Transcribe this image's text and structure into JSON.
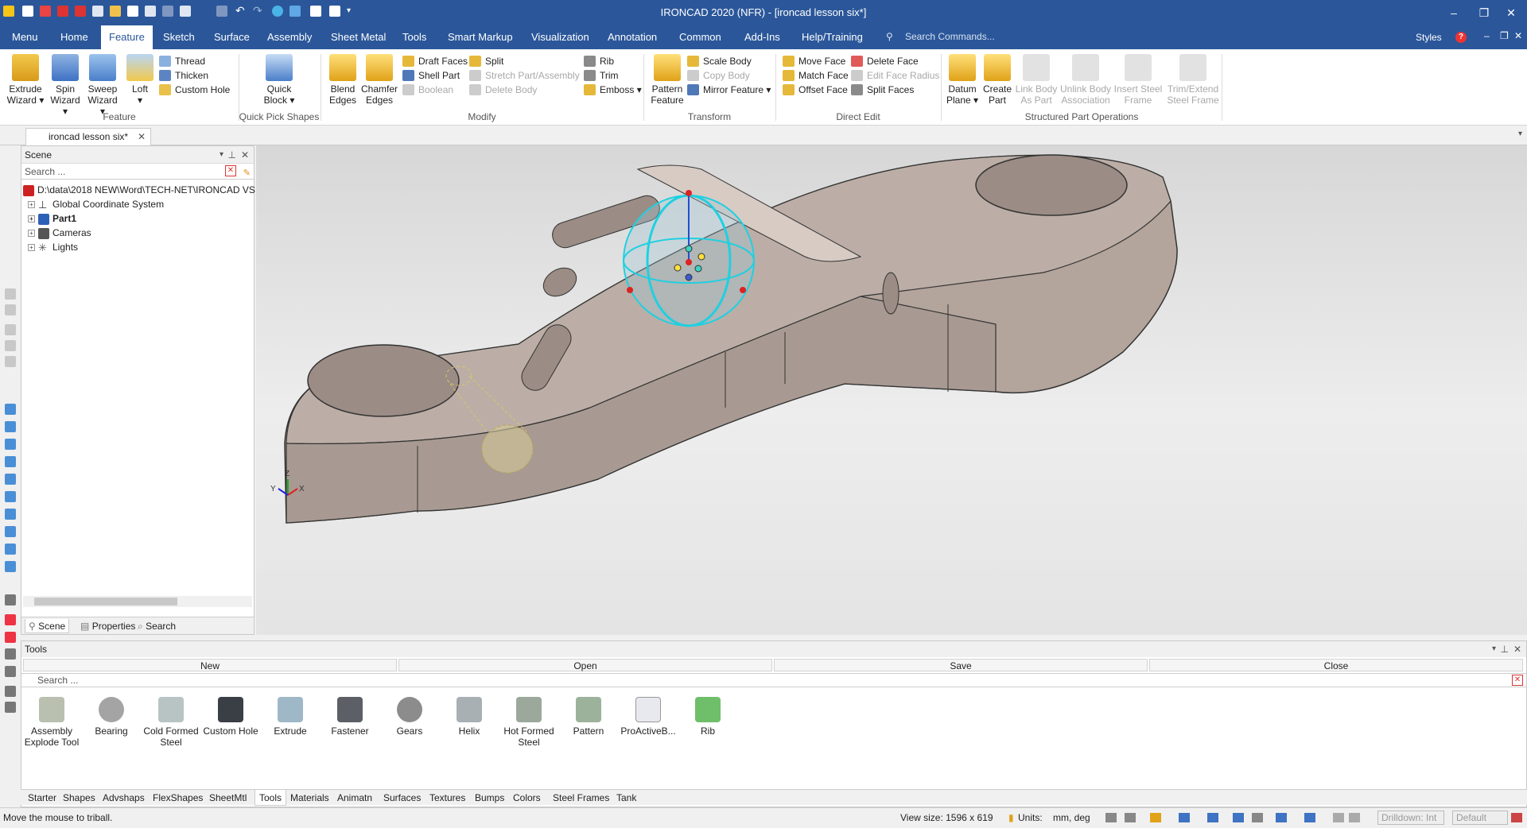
{
  "window": {
    "title": "IRONCAD 2020 (NFR) - [ironcad lesson six*]"
  },
  "menu": {
    "tabs": [
      "Menu",
      "Home",
      "Feature",
      "Sketch",
      "Surface",
      "Assembly",
      "Sheet Metal",
      "Tools",
      "Smart Markup",
      "Visualization",
      "Annotation",
      "Common",
      "Add-Ins",
      "Help/Training"
    ],
    "active_tab": "Feature",
    "search_placeholder": "Search Commands...",
    "styles_label": "Styles"
  },
  "ribbon": {
    "feature": {
      "extrude": "Extrude Wizard",
      "spin": "Spin Wizard",
      "sweep": "Sweep Wizard",
      "loft": "Loft",
      "thread": "Thread",
      "thicken": "Thicken",
      "custom_hole": "Custom Hole",
      "group": "Feature"
    },
    "quick_pick": {
      "quick_block": "Quick Block",
      "group": "Quick Pick Shapes"
    },
    "modify": {
      "blend": "Blend Edges",
      "chamfer": "Chamfer Edges",
      "draft": "Draft Faces",
      "shell": "Shell Part",
      "boolean": "Boolean",
      "split": "Split",
      "stretch": "Stretch Part/Assembly",
      "delete_body": "Delete Body",
      "rib": "Rib",
      "trim": "Trim",
      "emboss": "Emboss",
      "group": "Modify"
    },
    "transform": {
      "pattern": "Pattern Feature",
      "scale": "Scale Body",
      "copy": "Copy Body",
      "mirror": "Mirror Feature",
      "group": "Transform"
    },
    "direct_edit": {
      "move_face": "Move Face",
      "match_face": "Match Face",
      "offset_face": "Offset Face",
      "delete_face": "Delete Face",
      "edit_radius": "Edit Face Radius",
      "split_faces": "Split Faces",
      "group": "Direct Edit"
    },
    "structured": {
      "datum": "Datum Plane",
      "create_part": "Create Part",
      "link_body": "Link Body As Part",
      "unlink_body": "Unlink Body Association",
      "insert_steel": "Insert Steel Frame",
      "trim_steel": "Trim/Extend Steel Frame",
      "group": "Structured Part Operations"
    }
  },
  "doc_tab": {
    "label": "ironcad lesson six*"
  },
  "scene": {
    "title": "Scene",
    "search_placeholder": "Search ...",
    "root": "D:\\data\\2018 NEW\\Word\\TECH-NET\\IRONCAD VS",
    "items": [
      "Global Coordinate System",
      "Part1",
      "Cameras",
      "Lights"
    ],
    "tabs": [
      "Scene",
      "Properties",
      "Search"
    ]
  },
  "tools": {
    "title": "Tools",
    "actions": [
      "New",
      "Open",
      "Save",
      "Close"
    ],
    "search_placeholder": "Search ...",
    "items": [
      "Assembly Explode Tool",
      "Bearing",
      "Cold Formed Steel",
      "Custom Hole",
      "Extrude",
      "Fastener",
      "Gears",
      "Helix",
      "Hot Formed Steel",
      "Pattern",
      "ProActiveB...",
      "Rib"
    ]
  },
  "catalog_tabs": {
    "items": [
      "Starter",
      "Shapes",
      "Advshaps",
      "FlexShapes",
      "SheetMtl",
      "Tools",
      "Materials",
      "Animatn",
      "Surfaces",
      "Textures",
      "Bumps",
      "Colors",
      "Steel Frames",
      "Tank"
    ],
    "active": "Tools"
  },
  "status": {
    "message": "Move the mouse to triball.",
    "view_size": "View size: 1596 x 619",
    "units_label": "Units:",
    "units": "mm, deg",
    "drilldown": "Drilldown: Int",
    "default": "Default"
  },
  "axes": {
    "z": "Z",
    "y": "Y",
    "x": "X"
  },
  "colors": {
    "title_bar": "#2b579a",
    "part": "#b3a49c",
    "triball": "#1fd0e0"
  }
}
